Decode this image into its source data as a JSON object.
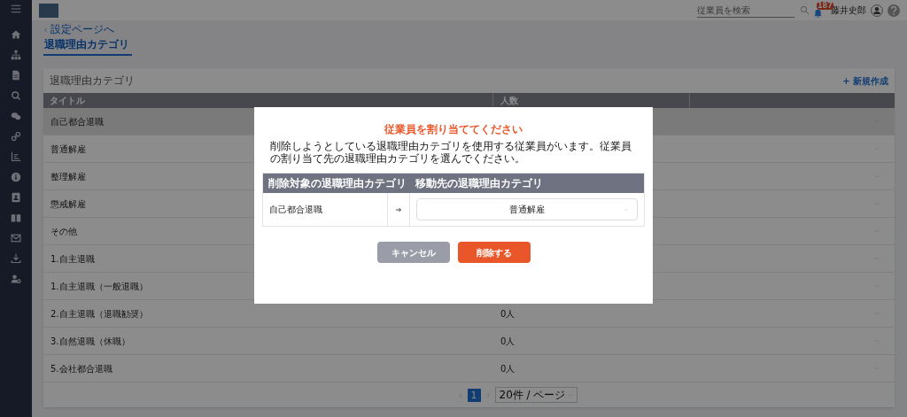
{
  "header": {
    "search": {
      "placeholder": "従業員を検索"
    },
    "notification_badge": "187",
    "user_name": "藤井史郎"
  },
  "sidebar": {
    "items": [
      {
        "kind": "home"
      },
      {
        "kind": "org"
      },
      {
        "kind": "doc"
      },
      {
        "kind": "search"
      },
      {
        "kind": "chat"
      },
      {
        "kind": "link"
      },
      {
        "kind": "chart"
      },
      {
        "kind": "info"
      },
      {
        "kind": "contact"
      },
      {
        "kind": "book"
      },
      {
        "kind": "mail"
      },
      {
        "kind": "download"
      },
      {
        "kind": "usergear"
      }
    ]
  },
  "breadcrumb": "設定ページへ",
  "tab": {
    "label": "退職理由カテゴリ",
    "selected": true
  },
  "card": {
    "title": "退職理由カテゴリ",
    "new_button": "+ 新規作成"
  },
  "table": {
    "columns": [
      "タイトル",
      "人数"
    ],
    "rows": [
      {
        "title": "自己都合退職",
        "selected": true
      },
      {
        "title": "普通解雇",
        "selected": false
      },
      {
        "title": "整理解雇",
        "selected": false
      },
      {
        "title": "懲戒解雇",
        "selected": false
      },
      {
        "title": "その他",
        "selected": false
      },
      {
        "title": "1.自主退職",
        "selected": false
      },
      {
        "title": "1.自主退職（一般退職）",
        "selected": false
      },
      {
        "title": "2.自主退職（退職勧奨）",
        "count": "0人",
        "selected": false
      },
      {
        "title": "3.自然退職（休職）",
        "count": "0人",
        "selected": false
      },
      {
        "title": "5.会社都合退職",
        "count": "0人",
        "selected": false
      }
    ]
  },
  "pagination": {
    "pages": [
      {
        "label": "1",
        "selected": true
      }
    ],
    "page_size": "20件 / ページ"
  },
  "modal": {
    "title": "従業員を割り当ててください",
    "message": "削除しようとしている退職理由カテゴリを使用する従業員がいます。従業員の割り当て先の退職理由カテゴリを選んでください。",
    "columns": [
      "削除対象の退職理由カテゴリ",
      "移動先の退職理由カテゴリ"
    ],
    "source": "自己都合退職",
    "target": "普通解雇",
    "cancel": "キャンセル",
    "delete": "削除する"
  }
}
